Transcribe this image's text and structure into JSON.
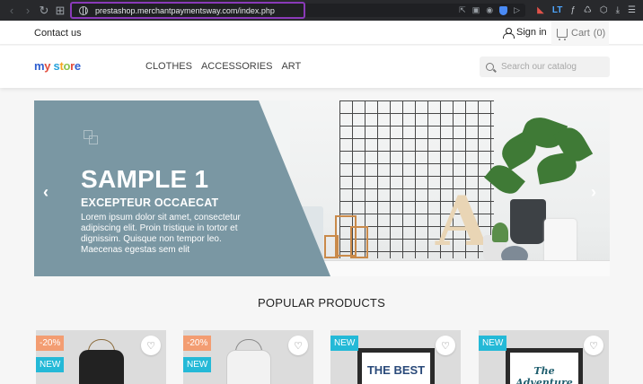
{
  "browser": {
    "url": "prestashop.merchantpaymentsway.com/index.php"
  },
  "topbar": {
    "contact": "Contact us",
    "signin": "Sign in",
    "cart": "Cart",
    "cart_count": "(0)"
  },
  "header": {
    "logo": "my store",
    "menu": [
      "CLOTHES",
      "ACCESSORIES",
      "ART"
    ],
    "search_placeholder": "Search our catalog"
  },
  "slider": {
    "title": "SAMPLE 1",
    "subtitle": "EXCEPTEUR OCCAECAT",
    "text": "Lorem ipsum dolor sit amet, consectetur adipiscing elit. Proin tristique in tortor et dignissim. Quisque non tempor leo. Maecenas egestas sem elit",
    "prev": "‹",
    "next": "›"
  },
  "products": {
    "title": "POPULAR PRODUCTS",
    "items": [
      {
        "discount": "-20%",
        "flag": "NEW"
      },
      {
        "discount": "-20%",
        "flag": "NEW"
      },
      {
        "flag": "NEW",
        "art_text": "THE BEST"
      },
      {
        "flag": "NEW",
        "art_text": "The Adventure"
      }
    ]
  },
  "colors": {
    "slider_blue": "#7a97a3",
    "discount_badge": "#f39d72",
    "new_badge": "#24b9d7",
    "address_highlight": "#8a3ab9"
  }
}
